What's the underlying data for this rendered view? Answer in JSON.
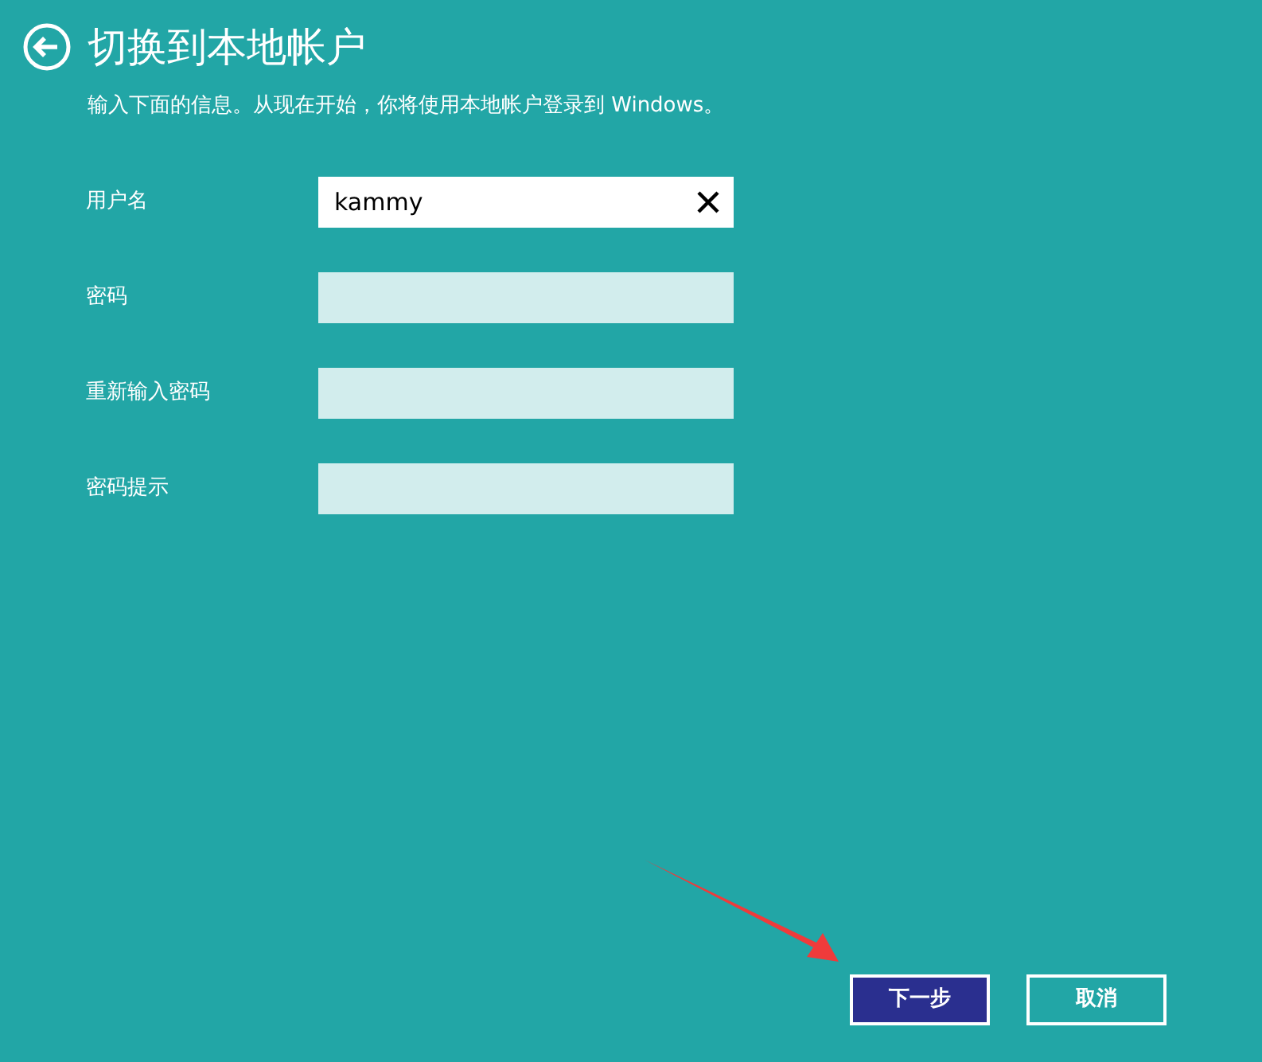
{
  "title": "切换到本地帐户",
  "subtitle": "输入下面的信息。从现在开始，你将使用本地帐户登录到 Windows。",
  "fields": [
    {
      "label": "用户名",
      "value": "kammy",
      "focused": true
    },
    {
      "label": "密码",
      "focused": false
    },
    {
      "label": "重新输入密码",
      "focused": false
    },
    {
      "label": "密码提示",
      "focused": false
    }
  ],
  "buttons": [
    {
      "label": "下一步",
      "kind": "primary"
    },
    {
      "label": "取消",
      "kind": "secondary"
    }
  ]
}
